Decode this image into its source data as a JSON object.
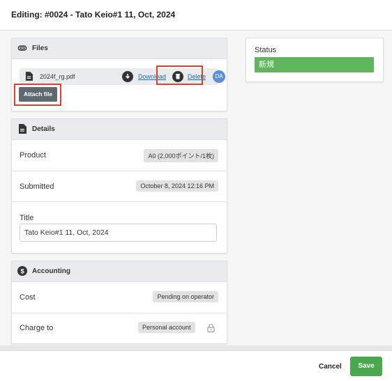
{
  "header": {
    "title": "Editing: #0024  -  Tato Keio#1 11, Oct, 2024"
  },
  "files": {
    "title": "Files",
    "file_name": "2024f_rg.pdf",
    "download_label": "Download",
    "delete_label": "Delete",
    "avatar_initials": "DA",
    "attach_label": "Attach file"
  },
  "details": {
    "title": "Details",
    "product_label": "Product",
    "product_value": "A0 (2,000ポイント/1枚)",
    "submitted_label": "Submitted",
    "submitted_value": "October 8, 2024 12:16 PM",
    "title_label": "Title",
    "title_value": "Tato Keio#1 11, Oct, 2024"
  },
  "accounting": {
    "title": "Accounting",
    "cost_label": "Cost",
    "cost_value": "Pending on operator",
    "charge_label": "Charge to",
    "charge_value": "Personal account"
  },
  "status": {
    "label": "Status",
    "value": "新規",
    "color": "#5fb65c"
  },
  "footer": {
    "cancel_label": "Cancel",
    "save_label": "Save"
  },
  "icons": [
    "paperclip-icon",
    "document-icon",
    "cloud-download-icon",
    "trash-icon",
    "dollar-icon",
    "lock-icon"
  ]
}
